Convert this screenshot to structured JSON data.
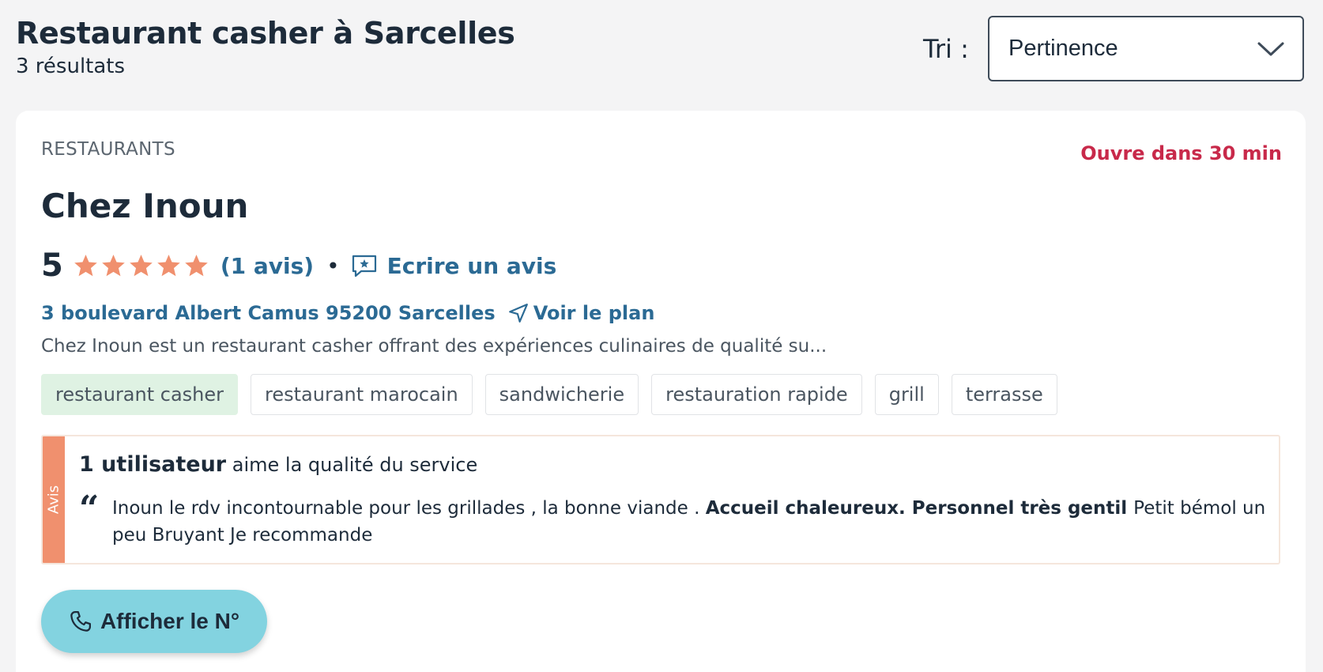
{
  "header": {
    "title": "Restaurant casher à Sarcelles",
    "result_count": "3 résultats"
  },
  "sort": {
    "label": "Tri :",
    "selected": "Pertinence"
  },
  "result": {
    "category": "RESTAURANTS",
    "open_status": "Ouvre dans 30 min",
    "name": "Chez Inoun",
    "rating": "5",
    "stars_filled": 5,
    "stars_total": 5,
    "reviews_link": "(1 avis)",
    "separator": "•",
    "write_review": "Ecrire un avis",
    "address": "3 boulevard Albert Camus 95200 Sarcelles",
    "map_link": "Voir le plan",
    "description": "Chez Inoun est un restaurant casher offrant des expériences culinaires de qualité su...",
    "tags": [
      "restaurant casher",
      "restaurant marocain",
      "sandwicherie",
      "restauration rapide",
      "grill",
      "terrasse"
    ],
    "review": {
      "side_label": "Avis",
      "headline_strong": "1 utilisateur",
      "headline_rest": " aime la qualité du service",
      "quote_mark": "“",
      "quote_before": "Inoun le rdv incontournable pour les grillades , la bonne viande . ",
      "quote_bold": " Accueil chaleureux. Personnel très gentil ",
      "quote_after": " Petit bémol un peu Bruyant Je recommande"
    },
    "phone_button": "Afficher le N°"
  },
  "colors": {
    "link": "#2b6a94",
    "open_status": "#c8294a",
    "star": "#f0906e",
    "review_tab": "#f0906e",
    "tag_highlight_bg": "#dff2e3",
    "phone_button_bg": "#83d3e0"
  },
  "icons": {
    "sort": "chevron-down-icon",
    "star": "star-icon",
    "write_review": "review-bubble-icon",
    "map": "navigation-arrow-icon",
    "phone": "phone-icon",
    "quote": "quote-icon"
  }
}
